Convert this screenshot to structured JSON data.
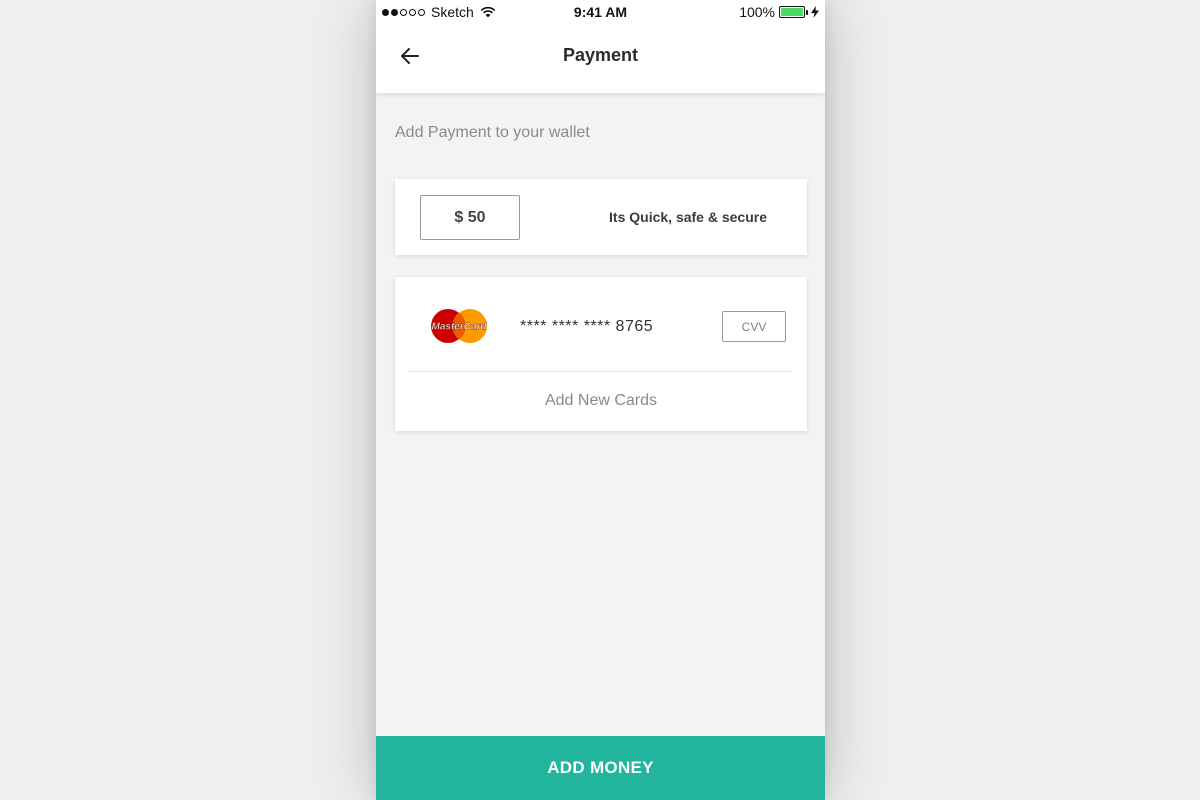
{
  "status_bar": {
    "carrier": "Sketch",
    "time": "9:41 AM",
    "battery": "100%",
    "battery_level": 1.0,
    "signal_bars_filled": 2,
    "signal_bars_total": 5
  },
  "header": {
    "title": "Payment",
    "back_icon": "arrow-left-icon"
  },
  "main": {
    "subtitle": "Add Payment to your wallet",
    "amount": {
      "value": "$ 50",
      "tagline": "Its Quick, safe & secure"
    },
    "saved_card": {
      "brand_logo": "mastercard-logo",
      "brand_text": "MasterCard",
      "number": "**** **** **** 8765",
      "cvv_placeholder": "CVV"
    },
    "add_new_cards_label": "Add New Cards"
  },
  "footer": {
    "add_money_label": "ADD MONEY"
  },
  "colors": {
    "accent": "#20b59c",
    "battery": "#4cd964",
    "mastercard_red": "#cc0000",
    "mastercard_orange": "#ff9900"
  }
}
